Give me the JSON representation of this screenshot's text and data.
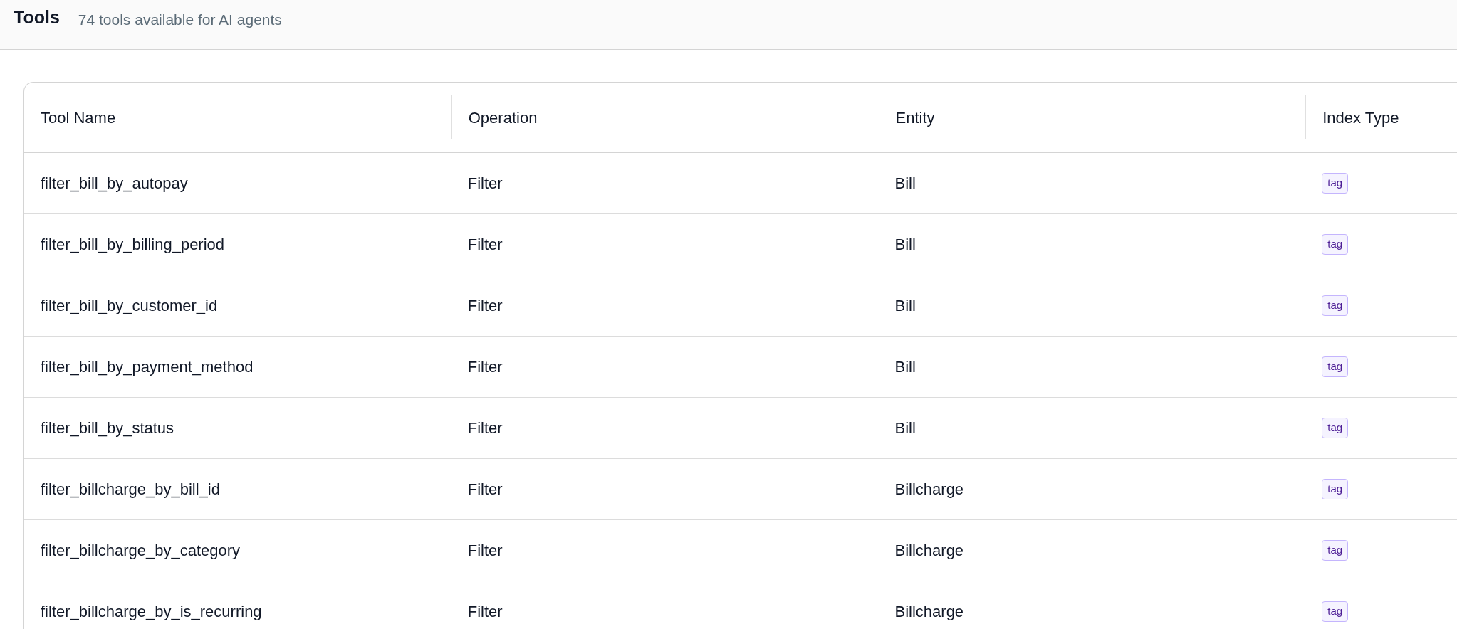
{
  "header": {
    "title": "Tools",
    "subtitle": "74 tools available for AI agents"
  },
  "table": {
    "columns": [
      "Tool Name",
      "Operation",
      "Entity",
      "Index Type"
    ],
    "rows": [
      {
        "tool_name": "filter_bill_by_autopay",
        "operation": "Filter",
        "entity": "Bill",
        "index_type": "tag"
      },
      {
        "tool_name": "filter_bill_by_billing_period",
        "operation": "Filter",
        "entity": "Bill",
        "index_type": "tag"
      },
      {
        "tool_name": "filter_bill_by_customer_id",
        "operation": "Filter",
        "entity": "Bill",
        "index_type": "tag"
      },
      {
        "tool_name": "filter_bill_by_payment_method",
        "operation": "Filter",
        "entity": "Bill",
        "index_type": "tag"
      },
      {
        "tool_name": "filter_bill_by_status",
        "operation": "Filter",
        "entity": "Bill",
        "index_type": "tag"
      },
      {
        "tool_name": "filter_billcharge_by_bill_id",
        "operation": "Filter",
        "entity": "Billcharge",
        "index_type": "tag"
      },
      {
        "tool_name": "filter_billcharge_by_category",
        "operation": "Filter",
        "entity": "Billcharge",
        "index_type": "tag"
      },
      {
        "tool_name": "filter_billcharge_by_is_recurring",
        "operation": "Filter",
        "entity": "Billcharge",
        "index_type": "tag"
      }
    ]
  }
}
